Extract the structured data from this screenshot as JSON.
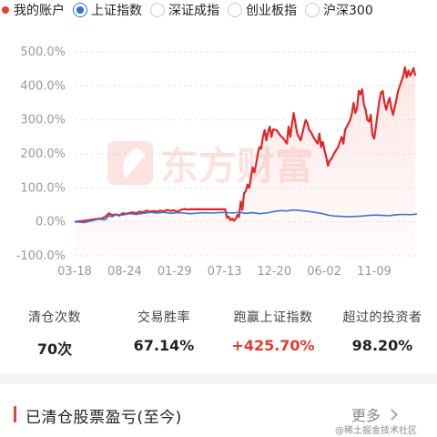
{
  "legend": {
    "my_account": "我的账户",
    "options": [
      {
        "label": "上证指数",
        "selected": true
      },
      {
        "label": "深证成指",
        "selected": false
      },
      {
        "label": "创业板指",
        "selected": false
      },
      {
        "label": "沪深300",
        "selected": false
      }
    ]
  },
  "watermark_text": "东方财富",
  "colors": {
    "account_line": "#e0262a",
    "index_line": "#3b74d4",
    "accent": "#e8412f",
    "selected_radio": "#2f6fe4",
    "positive_value": "#e03a2f"
  },
  "chart_data": {
    "type": "line",
    "x_tick_labels": [
      "03-18",
      "08-24",
      "01-29",
      "07-13",
      "12-20",
      "06-02",
      "11-09"
    ],
    "y_tick_labels": [
      "500.0%",
      "400.0%",
      "300.0%",
      "200.0%",
      "100.0%",
      "0.0%",
      "-100.0%"
    ],
    "ylim": [
      -100,
      500
    ],
    "x_range": [
      0,
      100
    ],
    "x_tick_positions": [
      0,
      14.6,
      29.2,
      43.8,
      58.3,
      72.9,
      87.5
    ],
    "grid": "horizontal-dashed",
    "series": [
      {
        "key": "account",
        "color": "#e0262a",
        "fill": true,
        "points": [
          [
            0,
            0
          ],
          [
            2,
            2
          ],
          [
            4,
            5
          ],
          [
            6,
            8
          ],
          [
            8,
            10
          ],
          [
            9,
            15
          ],
          [
            10,
            25
          ],
          [
            11,
            20
          ],
          [
            12,
            22
          ],
          [
            13,
            18
          ],
          [
            14,
            25
          ],
          [
            15,
            24
          ],
          [
            16,
            26
          ],
          [
            17,
            28
          ],
          [
            18,
            25
          ],
          [
            19,
            30
          ],
          [
            20,
            28
          ],
          [
            21,
            33
          ],
          [
            22,
            30
          ],
          [
            23,
            32
          ],
          [
            24,
            30
          ],
          [
            25,
            33
          ],
          [
            26,
            31
          ],
          [
            27,
            35
          ],
          [
            28,
            32
          ],
          [
            29,
            34
          ],
          [
            30,
            30
          ],
          [
            31,
            35
          ],
          [
            32,
            38
          ],
          [
            33,
            36
          ],
          [
            34,
            37
          ],
          [
            35,
            37
          ],
          [
            36,
            37
          ],
          [
            37,
            37
          ],
          [
            38,
            37
          ],
          [
            39,
            37
          ],
          [
            40,
            37
          ],
          [
            41,
            37
          ],
          [
            42,
            37
          ],
          [
            43,
            37
          ],
          [
            44,
            37
          ],
          [
            44.5,
            12
          ],
          [
            45,
            15
          ],
          [
            45.5,
            5
          ],
          [
            46,
            10
          ],
          [
            46.5,
            3
          ],
          [
            47,
            8
          ],
          [
            47.5,
            20
          ],
          [
            48,
            14
          ],
          [
            48.5,
            60
          ],
          [
            49,
            35
          ],
          [
            49.5,
            85
          ],
          [
            50,
            90
          ],
          [
            50.5,
            110
          ],
          [
            51,
            100
          ],
          [
            51.5,
            130
          ],
          [
            52,
            160
          ],
          [
            52.5,
            145
          ],
          [
            53,
            170
          ],
          [
            53.5,
            200
          ],
          [
            54,
            220
          ],
          [
            54.5,
            215
          ],
          [
            55,
            250
          ],
          [
            55.5,
            270
          ],
          [
            56,
            240
          ],
          [
            56.5,
            265
          ],
          [
            57,
            280
          ],
          [
            57.5,
            250
          ],
          [
            58,
            272
          ],
          [
            59,
            270
          ],
          [
            60,
            255
          ],
          [
            61,
            245
          ],
          [
            62,
            230
          ],
          [
            62.5,
            280
          ],
          [
            63,
            250
          ],
          [
            63.5,
            290
          ],
          [
            64,
            320
          ],
          [
            64.5,
            290
          ],
          [
            65,
            260
          ],
          [
            66,
            240
          ],
          [
            67,
            280
          ],
          [
            67.5,
            300
          ],
          [
            68,
            290
          ],
          [
            68.5,
            270
          ],
          [
            69,
            265
          ],
          [
            70,
            245
          ],
          [
            71,
            230
          ],
          [
            71.5,
            260
          ],
          [
            72,
            220
          ],
          [
            72.5,
            235
          ],
          [
            73,
            210
          ],
          [
            73.5,
            190
          ],
          [
            74,
            165
          ],
          [
            74.5,
            180
          ],
          [
            75,
            185
          ],
          [
            76,
            205
          ],
          [
            77,
            220
          ],
          [
            78,
            250
          ],
          [
            78.5,
            230
          ],
          [
            79,
            270
          ],
          [
            80,
            290
          ],
          [
            80.5,
            300
          ],
          [
            81,
            320
          ],
          [
            81.5,
            350
          ],
          [
            82,
            320
          ],
          [
            82.5,
            335
          ],
          [
            83,
            385
          ],
          [
            83.5,
            375
          ],
          [
            84,
            390
          ],
          [
            84.5,
            345
          ],
          [
            85,
            330
          ],
          [
            85.5,
            300
          ],
          [
            86,
            295
          ],
          [
            86.5,
            315
          ],
          [
            87,
            255
          ],
          [
            87.5,
            245
          ],
          [
            88,
            280
          ],
          [
            88.5,
            320
          ],
          [
            89,
            355
          ],
          [
            89.5,
            380
          ],
          [
            90,
            385
          ],
          [
            90.5,
            350
          ],
          [
            91,
            330
          ],
          [
            91.5,
            350
          ],
          [
            92,
            365
          ],
          [
            92.5,
            335
          ],
          [
            93,
            315
          ],
          [
            93.5,
            338
          ],
          [
            94,
            360
          ],
          [
            94.5,
            385
          ],
          [
            95,
            400
          ],
          [
            95.5,
            415
          ],
          [
            96,
            430
          ],
          [
            96.5,
            455
          ],
          [
            97,
            425
          ],
          [
            97.5,
            445
          ],
          [
            98,
            430
          ],
          [
            98.5,
            440
          ],
          [
            99,
            452
          ],
          [
            99.5,
            430
          ]
        ]
      },
      {
        "key": "index",
        "color": "#3b74d4",
        "fill": false,
        "points": [
          [
            0,
            0
          ],
          [
            3,
            -2
          ],
          [
            5,
            3
          ],
          [
            7,
            8
          ],
          [
            9,
            6
          ],
          [
            10,
            18
          ],
          [
            11,
            15
          ],
          [
            12,
            22
          ],
          [
            14,
            20
          ],
          [
            16,
            24
          ],
          [
            18,
            22
          ],
          [
            20,
            25
          ],
          [
            22,
            28
          ],
          [
            24,
            26
          ],
          [
            26,
            28
          ],
          [
            28,
            25
          ],
          [
            30,
            27
          ],
          [
            32,
            26
          ],
          [
            34,
            24
          ],
          [
            36,
            26
          ],
          [
            38,
            27
          ],
          [
            40,
            26
          ],
          [
            42,
            27
          ],
          [
            44,
            28
          ],
          [
            46,
            26
          ],
          [
            48,
            28
          ],
          [
            50,
            25
          ],
          [
            52,
            27
          ],
          [
            54,
            24
          ],
          [
            56,
            26
          ],
          [
            58,
            30
          ],
          [
            60,
            33
          ],
          [
            62,
            32
          ],
          [
            64,
            35
          ],
          [
            66,
            33
          ],
          [
            68,
            31
          ],
          [
            70,
            28
          ],
          [
            72,
            25
          ],
          [
            74,
            20
          ],
          [
            75,
            18
          ],
          [
            76,
            17
          ],
          [
            78,
            16
          ],
          [
            80,
            15
          ],
          [
            82,
            16
          ],
          [
            84,
            17
          ],
          [
            86,
            19
          ],
          [
            88,
            20
          ],
          [
            90,
            19
          ],
          [
            92,
            18
          ],
          [
            94,
            21
          ],
          [
            96,
            22
          ],
          [
            98,
            21
          ],
          [
            100,
            23
          ]
        ]
      }
    ]
  },
  "stats": [
    {
      "label": "清仓次数",
      "value": "70次",
      "style": "normal"
    },
    {
      "label": "交易胜率",
      "value": "67.14%",
      "style": "normal"
    },
    {
      "label": "跑赢上证指数",
      "value": "+425.70%",
      "style": "up"
    },
    {
      "label": "超过的投资者",
      "value": "98.20%",
      "style": "normal"
    }
  ],
  "section": {
    "title": "已清仓股票盈亏(至今)",
    "more_label": "更多"
  },
  "bottom_watermark": "@稀土掘金技术社区"
}
